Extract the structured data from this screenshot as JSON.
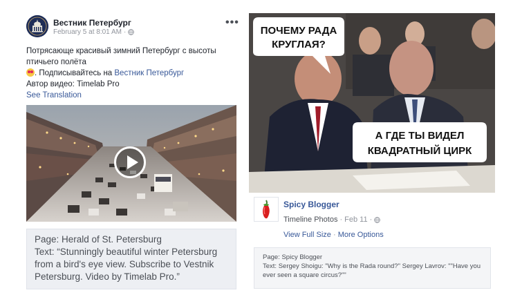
{
  "left_post": {
    "page_name": "Вестник Петербург",
    "timestamp": "February 5 at 8:01 AM",
    "separator": "·",
    "text_line1": "Потрясающе красивый зимний Петербург с высоты",
    "text_line2": "птичьего полёта",
    "subscribe_prefix": ". Подписывайтесь на ",
    "subscribe_link": "Вестник Петербург",
    "author_line": "Автор видео: Timelab Pro",
    "see_translation": "See Translation",
    "more_button": "•••",
    "caption_page": "Page: Herald of St. Petersburg",
    "caption_text": "Text: “Stunningly beautiful winter Petersburg from a bird's eye view. Subscribe to Vestnik Petersburg. Video by Timelab Pro.”"
  },
  "right_post": {
    "meme_text_top_1": "ПОЧЕМУ РАДА",
    "meme_text_top_2": "КРУГЛАЯ?",
    "meme_text_bottom_1": "А ГДЕ ТЫ ВИДЕЛ",
    "meme_text_bottom_2": "КВАДРАТНЫЙ ЦИРК",
    "page_name": "Spicy Blogger",
    "album": "Timeline Photos",
    "date": "Feb 11",
    "separator": "·",
    "view_full_size": "View Full Size",
    "more_options": "More Options",
    "caption_page": "Page: Spicy Blogger",
    "caption_text": "Text: Sergey Shoigu: \"Why is the Rada round?\" Sergey Lavrov: \"\"Have you ever seen a square circus?\"\""
  },
  "icons": {
    "globe": "globe-icon",
    "play": "play-icon",
    "emoji": "heart-eyes-emoji-icon",
    "pepper": "chili-pepper-icon"
  }
}
